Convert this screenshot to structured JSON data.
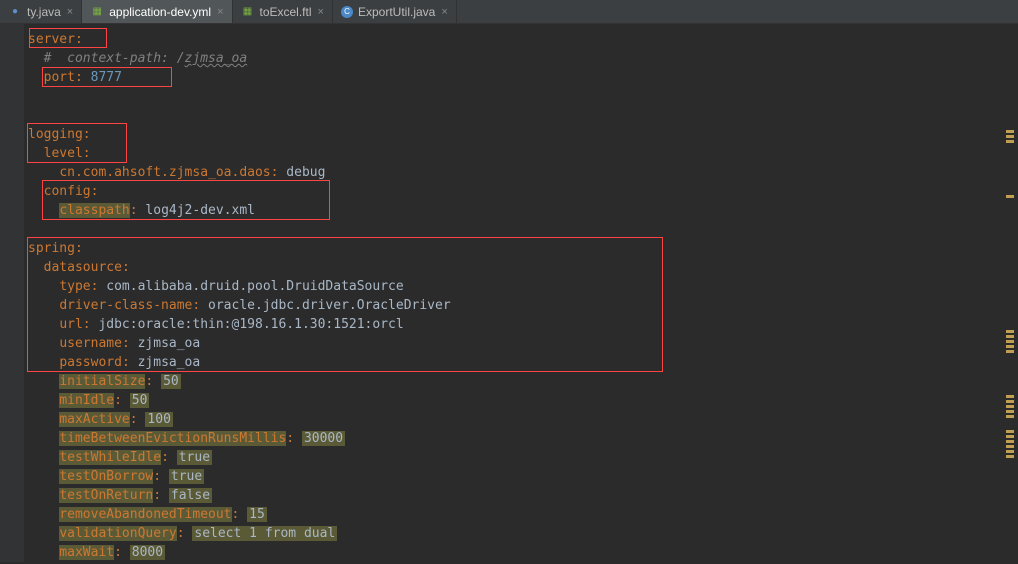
{
  "tabs": [
    {
      "label": "ty.java",
      "icon": "J",
      "active": false
    },
    {
      "label": "application-dev.yml",
      "icon": "Y",
      "active": true
    },
    {
      "label": "toExcel.ftl",
      "icon": "F",
      "active": false
    },
    {
      "label": "ExportUtil.java",
      "icon": "C",
      "active": false
    }
  ],
  "code": {
    "l1_key": "server",
    "l2_comment": "#  context-path: /",
    "l2_comment2": "zjmsa_oa",
    "l3_key": "port",
    "l3_val": "8777",
    "l5_key": "logging",
    "l6_key": "level",
    "l7_key": "cn.com.ahsoft.zjmsa_oa.daos",
    "l7_val": "debug",
    "l8_key": "config",
    "l9_key": "classpath",
    "l9_val": "log4j2-dev.xml",
    "l11_key": "spring",
    "l12_key": "datasource",
    "l13_key": "type",
    "l13_val": "com.alibaba.druid.pool.DruidDataSource",
    "l14_key": "driver-class-name",
    "l14_val": "oracle.jdbc.driver.OracleDriver",
    "l15_key": "url",
    "l15_val": "jdbc:oracle:thin:@198.16.1.30:1521:orcl",
    "l16_key": "username",
    "l16_val": "zjmsa_oa",
    "l17_key": "password",
    "l17_val": "zjmsa_oa",
    "l18_key": "initialSize",
    "l18_val": "50",
    "l19_key": "minIdle",
    "l19_val": "50",
    "l20_key": "maxActive",
    "l20_val": "100",
    "l21_key": "timeBetweenEvictionRunsMillis",
    "l21_val": "30000",
    "l22_key": "testWhileIdle",
    "l22_val": "true",
    "l23_key": "testOnBorrow",
    "l23_val": "true",
    "l24_key": "testOnReturn",
    "l24_val": "false",
    "l25_key": "removeAbandonedTimeout",
    "l25_val": "15",
    "l26_key": "validationQuery",
    "l26_val": "select 1 from dual",
    "l27_key": "maxWait",
    "l27_val": "8000"
  }
}
